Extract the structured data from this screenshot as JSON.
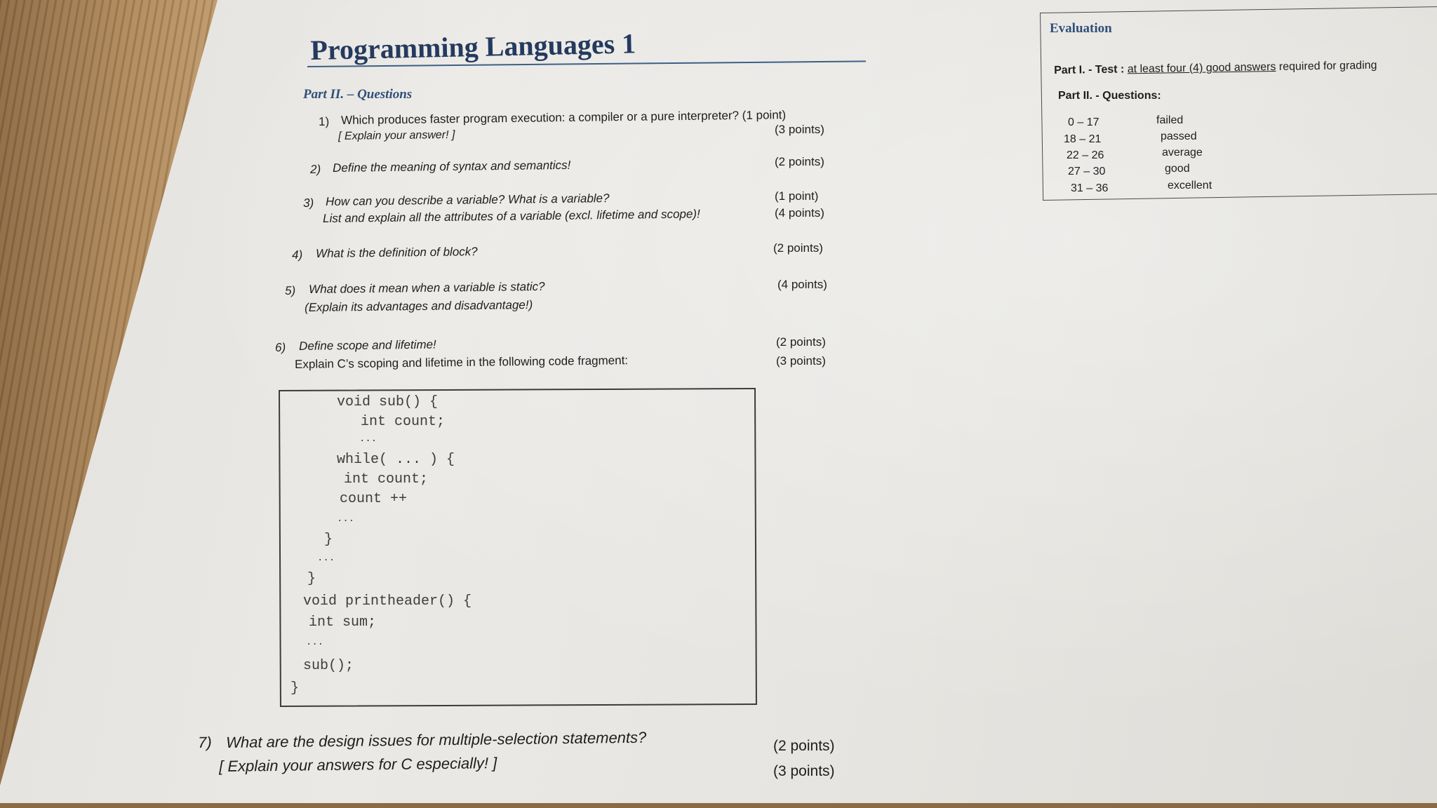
{
  "doc": {
    "title": "Programming Languages 1",
    "section": "Part II. – Questions"
  },
  "questions": [
    {
      "num": "1)",
      "lines": [
        "Which produces faster program execution: a compiler or a pure interpreter? (1 point)",
        "[ Explain your answer! ]"
      ],
      "points": [
        "(3 points)"
      ]
    },
    {
      "num": "2)",
      "lines": [
        "Define the meaning of syntax and semantics!"
      ],
      "points": [
        "(2 points)"
      ]
    },
    {
      "num": "3)",
      "lines": [
        "How can you describe a variable? What is a variable?",
        "List and explain all the attributes of a variable (excl. lifetime and scope)!"
      ],
      "points": [
        "(1 point)",
        "(4 points)"
      ]
    },
    {
      "num": "4)",
      "lines": [
        "What is the definition of block?"
      ],
      "points": [
        "(2 points)"
      ]
    },
    {
      "num": "5)",
      "lines": [
        "What does it mean when a variable is static?",
        "(Explain its advantages and disadvantage!)"
      ],
      "points": [
        "(4 points)"
      ]
    },
    {
      "num": "6)",
      "lines": [
        "Define scope and lifetime!",
        "Explain C’s scoping and lifetime in the following code fragment:"
      ],
      "points": [
        "(2 points)",
        "(3 points)"
      ]
    },
    {
      "num": "7)",
      "lines": [
        "What are the design issues for multiple-selection statements?",
        "[ Explain your answers for C especially! ]"
      ],
      "points": [
        "(2 points)",
        "(3 points)"
      ]
    }
  ],
  "code_lines": [
    "void sub() {",
    "int count;",
    "...",
    "while( ... ) {",
    "int count;",
    "count ++",
    "...",
    "}",
    "...",
    "}",
    "void printheader() {",
    "int sum;",
    "...",
    "sub();",
    "}"
  ],
  "evaluation": {
    "title": "Evaluation",
    "part1_label": "Part I. - Test :",
    "part1_underlined": "at least four (4) good answers",
    "part1_rest": "required for grading",
    "part2_label": "Part II. - Questions:",
    "grades": [
      {
        "range": "0 – 17",
        "grade": "failed"
      },
      {
        "range": "18 – 21",
        "grade": "passed"
      },
      {
        "range": "22 – 26",
        "grade": "average"
      },
      {
        "range": "27 – 30",
        "grade": "good"
      },
      {
        "range": "31 – 36",
        "grade": "excellent"
      }
    ]
  }
}
